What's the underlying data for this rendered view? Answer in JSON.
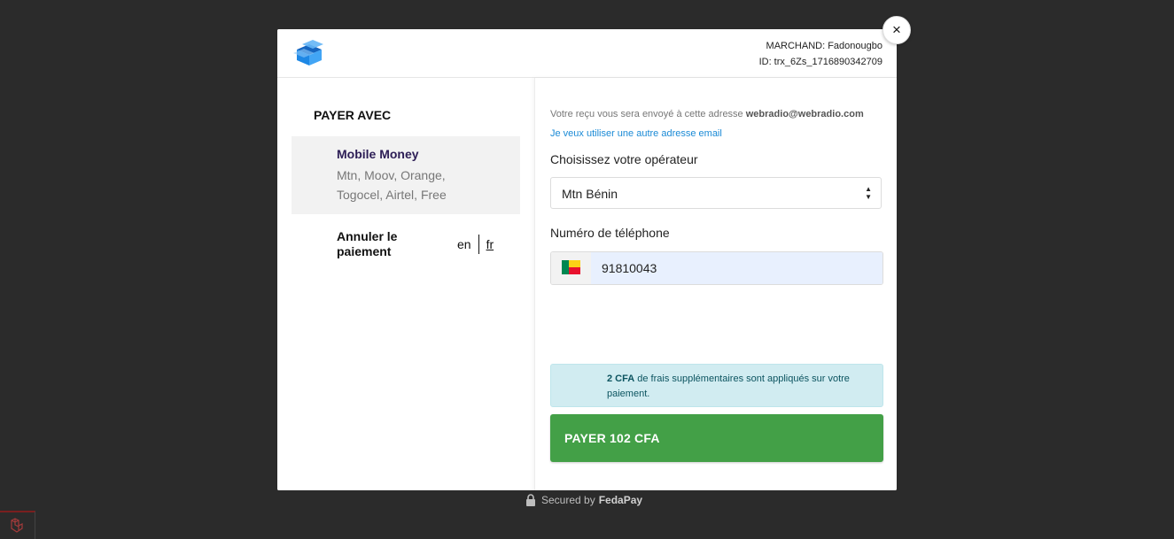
{
  "header": {
    "merchant": "MARCHAND: Fadonougbo",
    "transaction_id": "ID: trx_6Zs_1716890342709"
  },
  "close_label": "×",
  "left": {
    "pay_with": "PAYER AVEC",
    "method": {
      "title": "Mobile Money",
      "subtitle": "Mtn, Moov, Orange, Togocel, Airtel, Free"
    },
    "cancel": "Annuler le paiement",
    "lang_en": "en",
    "lang_fr": "fr"
  },
  "right": {
    "receipt_prefix": "Votre reçu vous sera envoyé à cette adresse ",
    "receipt_email": "webradio@webradio.com",
    "alt_email_link": "Je veux utiliser une autre adresse email",
    "operator_label": "Choisissez votre opérateur",
    "operator_value": "Mtn Bénin",
    "phone_label": "Numéro de téléphone",
    "phone_value": "91810043",
    "fee_amount": "2 CFA",
    "fee_text": " de frais supplémentaires sont appliqués sur votre paiement.",
    "pay_button": "PAYER 102 CFA"
  },
  "footer": {
    "secured_by": "Secured by",
    "brand": "FedaPay"
  },
  "colors": {
    "accent_green": "#43a047",
    "link_blue": "#1a8ad6",
    "info_bg": "#d1ecf1",
    "method_title": "#2c1d55"
  },
  "icons": [
    "logo-icon",
    "close-icon",
    "select-arrows-icon",
    "benin-flag-icon",
    "lock-icon",
    "laravel-icon"
  ]
}
